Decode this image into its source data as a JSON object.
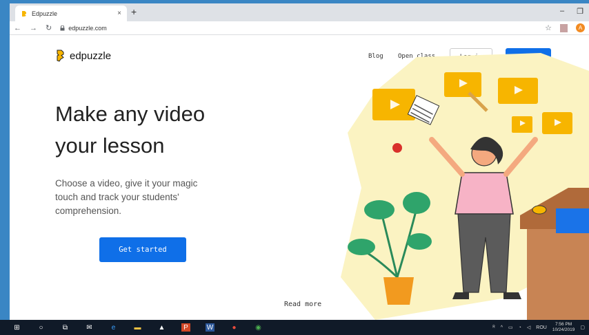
{
  "browser": {
    "tab_title": "Edpuzzle",
    "tab_close": "×",
    "new_tab": "+",
    "minimize": "–",
    "restore": "❐",
    "url": "edpuzzle.com",
    "avatar_letter": "A",
    "icons": [
      "back-icon",
      "forward-icon",
      "reload-icon",
      "lock-icon",
      "star-icon",
      "extension-icon"
    ]
  },
  "site": {
    "logo_text": "edpuzzle",
    "nav": {
      "blog": "Blog",
      "open_class": "Open class",
      "login": "Log in",
      "signup": "Sign up"
    },
    "hero": {
      "line1": "Make any video",
      "line2": "your lesson",
      "subtitle": "Choose a video, give it your magic touch and track your students' comprehension.",
      "cta": "Get started"
    },
    "read_more": "Read more"
  },
  "taskbar": {
    "tray_language": "ROU",
    "time": "7:56 PM",
    "date": "10/24/2019",
    "icons": [
      "windows-icon",
      "search-icon",
      "task-view-icon",
      "mail-icon",
      "edge-icon",
      "file-explorer-icon",
      "photos-icon",
      "powerpoint-icon",
      "word-icon",
      "maps-icon",
      "chrome-icon"
    ]
  },
  "colors": {
    "accent": "#0f6fe8",
    "brand_yellow": "#f7b500",
    "illustration_bg": "#fbf3c2"
  }
}
